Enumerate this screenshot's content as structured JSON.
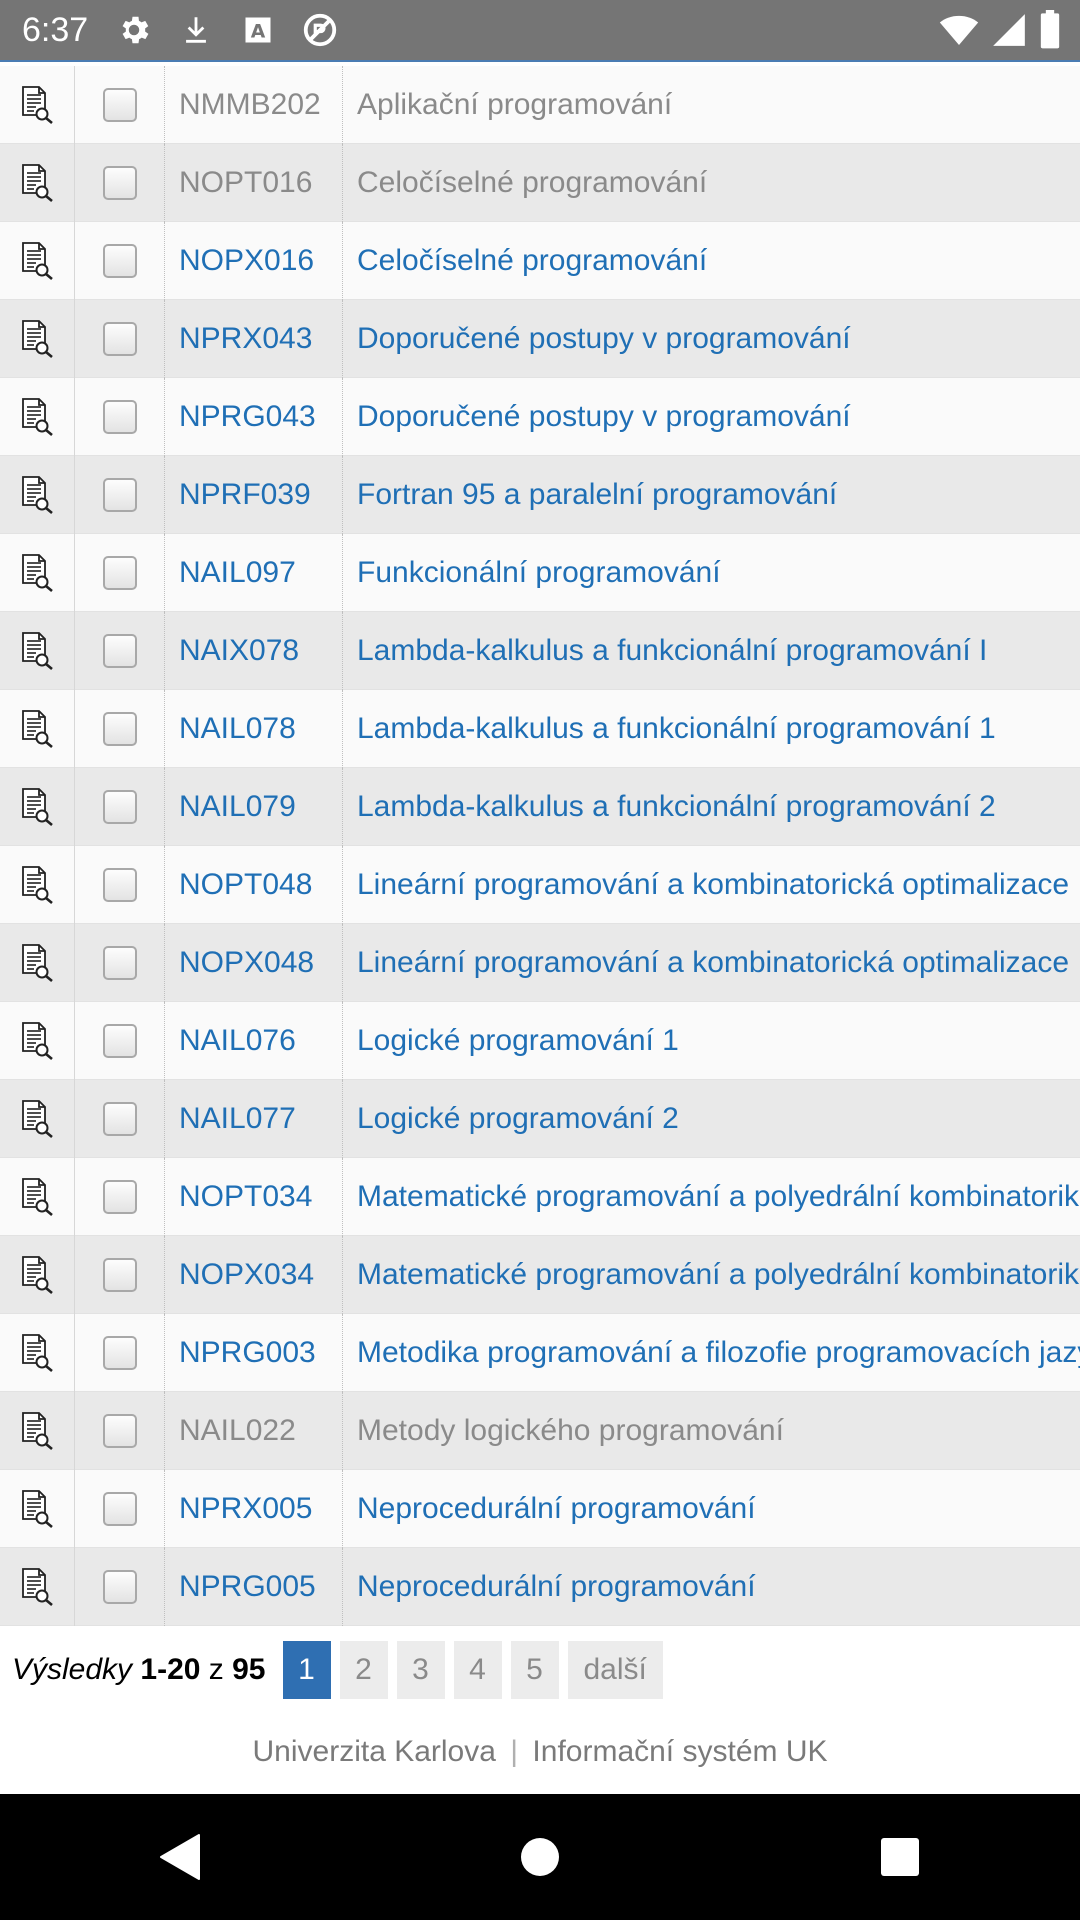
{
  "status_bar": {
    "time": "6:37",
    "icons": [
      "settings-icon",
      "download-icon",
      "text-a-icon",
      "accessibility-icon"
    ],
    "right_icons": [
      "wifi-icon",
      "signal-icon",
      "battery-icon"
    ]
  },
  "rows": [
    {
      "code": "NMMB202",
      "name": "Aplikační programování",
      "active": false
    },
    {
      "code": "NOPT016",
      "name": "Celočíselné programování",
      "active": false
    },
    {
      "code": "NOPX016",
      "name": "Celočíselné programování",
      "active": true
    },
    {
      "code": "NPRX043",
      "name": "Doporučené postupy v programování",
      "active": true
    },
    {
      "code": "NPRG043",
      "name": "Doporučené postupy v programování",
      "active": true
    },
    {
      "code": "NPRF039",
      "name": "Fortran 95 a paralelní programování",
      "active": true
    },
    {
      "code": "NAIL097",
      "name": "Funkcionální programování",
      "active": true
    },
    {
      "code": "NAIX078",
      "name": "Lambda-kalkulus a funkcionální programování I",
      "active": true
    },
    {
      "code": "NAIL078",
      "name": "Lambda-kalkulus a funkcionální programování 1",
      "active": true
    },
    {
      "code": "NAIL079",
      "name": "Lambda-kalkulus a funkcionální programování 2",
      "active": true
    },
    {
      "code": "NOPT048",
      "name": "Lineární programování a kombinatorická optimalizace",
      "active": true
    },
    {
      "code": "NOPX048",
      "name": "Lineární programování a kombinatorická optimalizace",
      "active": true
    },
    {
      "code": "NAIL076",
      "name": "Logické programování 1",
      "active": true
    },
    {
      "code": "NAIL077",
      "name": "Logické programování 2",
      "active": true
    },
    {
      "code": "NOPT034",
      "name": "Matematické programování a polyedrální kombinatorika",
      "active": true
    },
    {
      "code": "NOPX034",
      "name": "Matematické programování a polyedrální kombinatorika",
      "active": true
    },
    {
      "code": "NPRG003",
      "name": "Metodika programování a filozofie programovacích jazyků",
      "active": true
    },
    {
      "code": "NAIL022",
      "name": "Metody logického programování",
      "active": false
    },
    {
      "code": "NPRX005",
      "name": "Neprocedurální programování",
      "active": true
    },
    {
      "code": "NPRG005",
      "name": "Neprocedurální programování",
      "active": true
    }
  ],
  "pagination": {
    "results_word": "Výsledky",
    "range": "1-20",
    "of_word": "z",
    "total": "95",
    "pages": [
      "1",
      "2",
      "3",
      "4",
      "5"
    ],
    "current_page": "1",
    "next_label": "další"
  },
  "footer": {
    "university": "Univerzita Karlova",
    "separator": "|",
    "system": "Informační systém UK"
  },
  "nav_bar": {
    "icons": [
      "back-icon",
      "home-icon",
      "recents-icon"
    ]
  }
}
